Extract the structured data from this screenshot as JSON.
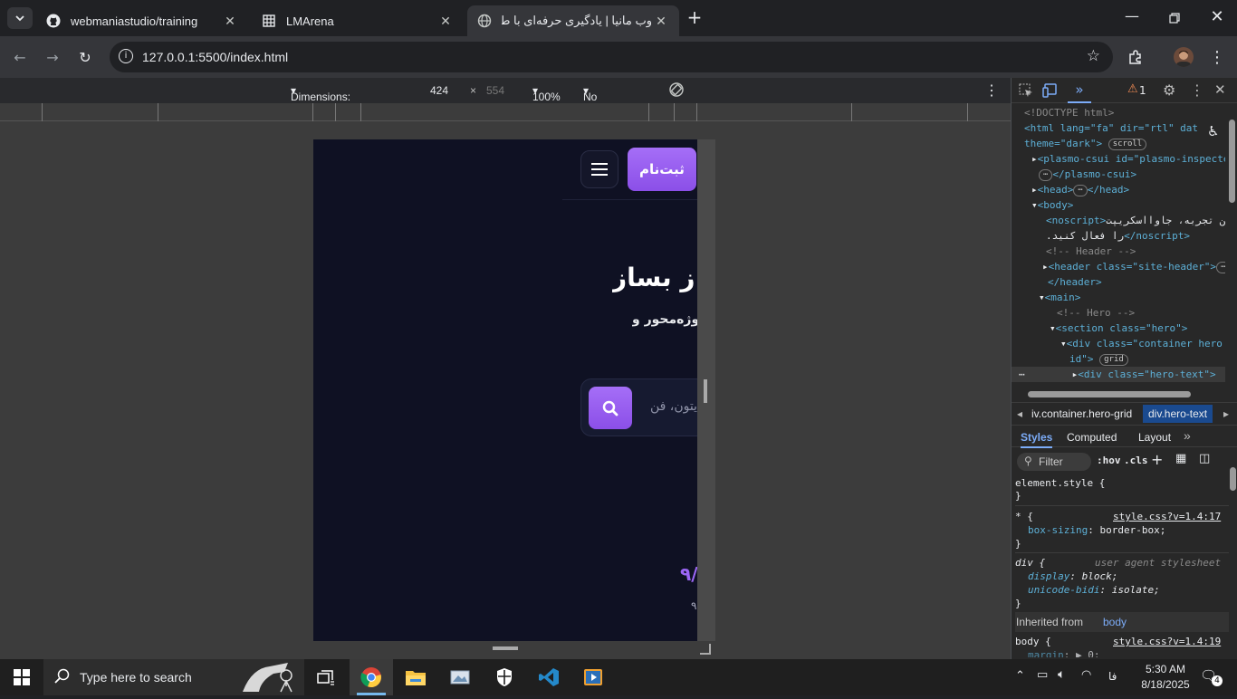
{
  "tabs": [
    {
      "title": "webmaniastudio/training",
      "icon": "github-icon"
    },
    {
      "title": "LMArena",
      "icon": "grid-icon"
    },
    {
      "title": "وب مانیا | یادگیری حرفه‌ای با طعم",
      "icon": "globe-icon",
      "active": true
    }
  ],
  "address": {
    "url": "127.0.0.1:5500/index.html"
  },
  "device_toolbar": {
    "dimensions_label": "Dimensions: Responsive",
    "width": "424",
    "sep": "×",
    "height": "554",
    "zoom": "100%",
    "throttling": "No throttling"
  },
  "page": {
    "signup_label": "ثبت‌نام",
    "hero_title": "ز بساز",
    "hero_sub": "پروژه‌محور و",
    "search_placeholder": "یتون، فن",
    "stat_value": "۹/",
    "stat_label": "۹"
  },
  "devtools": {
    "warning_count": "1",
    "dom_lines": [
      {
        "indent": 14,
        "html": "doctype",
        "text": "<!DOCTYPE html>"
      },
      {
        "indent": 14,
        "html": "htmltag"
      },
      {
        "indent": 14,
        "html": "theme"
      },
      {
        "indent": 22,
        "html": "plasmo"
      },
      {
        "indent": 30,
        "html": "plasmo-close"
      },
      {
        "indent": 22,
        "html": "head"
      },
      {
        "indent": 22,
        "html": "body"
      },
      {
        "indent": 38,
        "html": "noscript1"
      },
      {
        "indent": 38,
        "html": "noscript2"
      },
      {
        "indent": 38,
        "html": "comment-header"
      },
      {
        "indent": 34,
        "html": "header"
      },
      {
        "indent": 38,
        "html": "header-close"
      },
      {
        "indent": 34,
        "html": "main"
      },
      {
        "indent": 50,
        "html": "comment-hero"
      },
      {
        "indent": 46,
        "html": "section"
      },
      {
        "indent": 58,
        "html": "div-container"
      },
      {
        "indent": 64,
        "html": "div-container-2"
      },
      {
        "indent": 70,
        "html": "div-hero-text"
      }
    ],
    "dom_text": {
      "htmltag": "<html lang=\"fa\" dir=\"rtl\" dat",
      "theme": "theme=\"dark\">",
      "scroll_pill": "scroll",
      "plasmo": "<plasmo-csui id=\"plasmo-inspecte",
      "plasmo_close": "</plasmo-csui>",
      "head": "<head>",
      "head_close": "</head>",
      "body": "<body>",
      "noscript1_a": "<noscript>",
      "noscript1_b": "ی بهترین تجربه، جاوااسکریپت",
      "noscript2_a": ".را فعال کنید",
      "noscript2_b": "</noscript>",
      "comment_header": "<!-- Header -->",
      "header": "<header class=\"site-header\">",
      "header_close": "</header>",
      "main": "<main>",
      "comment_hero": "<!-- Hero -->",
      "section": "<section class=\"hero\">",
      "div_container": "<div class=\"container hero",
      "div_container_2": "id\">",
      "grid_pill": "grid",
      "div_hero_text": "<div class=\"hero-text\">"
    },
    "breadcrumbs": [
      "iv.container.hero-grid",
      "div.hero-text"
    ],
    "style_tabs": [
      "Styles",
      "Computed",
      "Layout"
    ],
    "filter_placeholder": "Filter",
    "hov": ":hov",
    "cls": ".cls",
    "rules": {
      "element_style": "element.style {",
      "close": "}",
      "star_sel": "* {",
      "star_src": "style.css?v=1.4:17",
      "box_sizing_prop": "box-sizing",
      "box_sizing_val": "border-box;",
      "div_sel": "div {",
      "div_src": "user agent stylesheet",
      "display_prop": "display",
      "display_val": "block;",
      "bidi_prop": "unicode-bidi",
      "bidi_val": "isolate;",
      "inherited_label": "Inherited from",
      "inherited_el": "body",
      "body_sel": "body {",
      "body_src": "style.css?v=1.4:19",
      "margin_prop": "margin",
      "margin_val": "▶ 0;"
    }
  },
  "taskbar": {
    "search_placeholder": "Type here to search",
    "time": "5:30 AM",
    "date": "8/18/2025",
    "lang": "فا",
    "notif_count": "4"
  }
}
